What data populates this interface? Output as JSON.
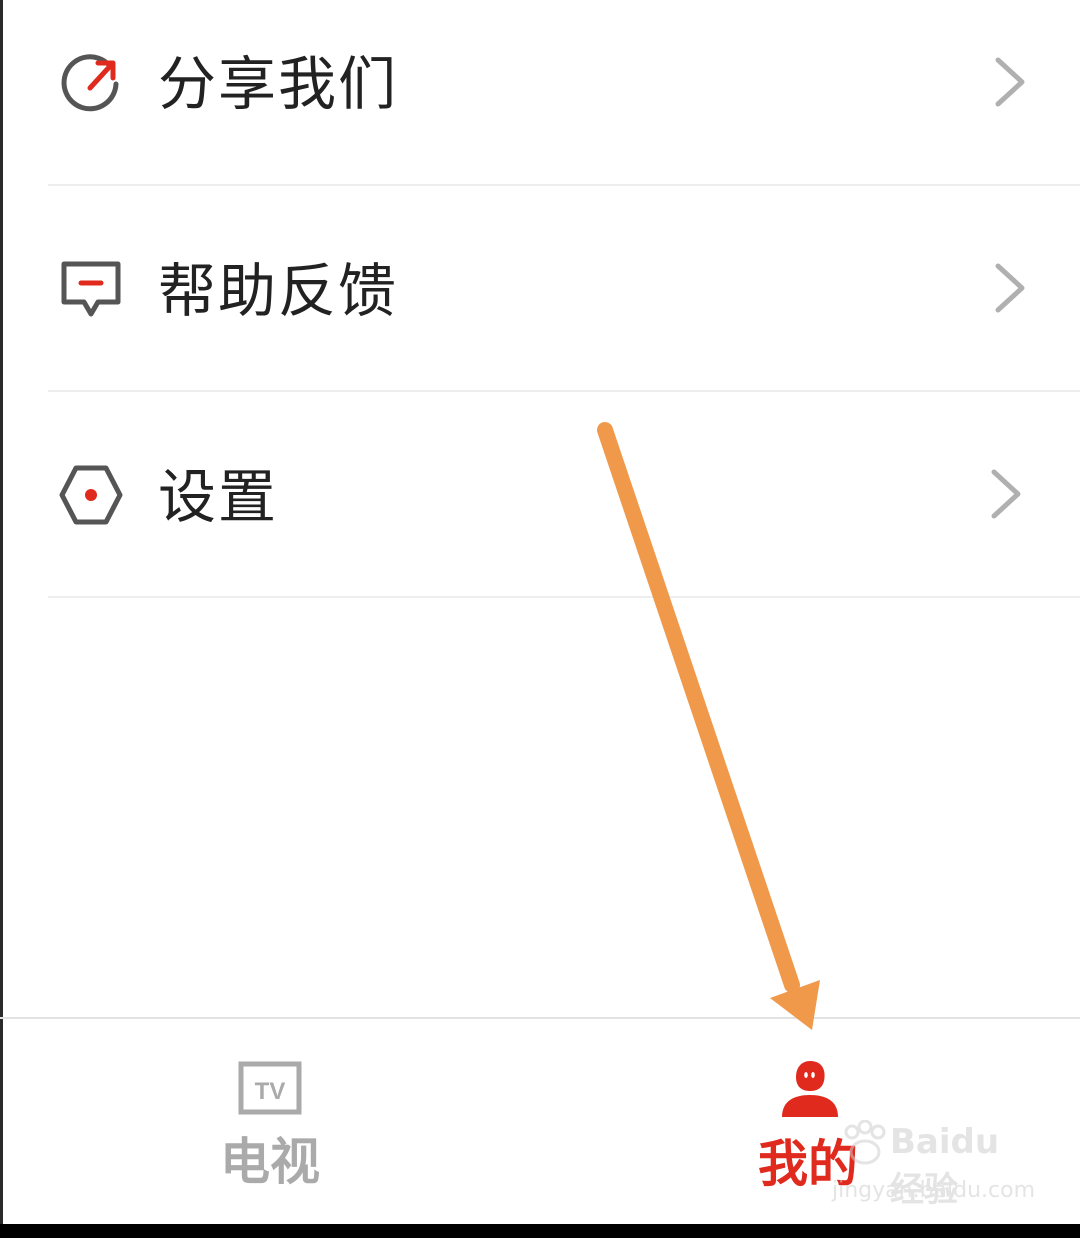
{
  "menu": {
    "items": [
      {
        "label": "分享我们",
        "icon": "share-icon"
      },
      {
        "label": "帮助反馈",
        "icon": "feedback-icon"
      },
      {
        "label": "设置",
        "icon": "settings-icon"
      }
    ]
  },
  "tabbar": {
    "tabs": [
      {
        "label": "电视",
        "icon": "tv-icon",
        "icon_text": "TV",
        "active": false
      },
      {
        "label": "我的",
        "icon": "profile-icon",
        "active": true
      }
    ]
  },
  "watermark": {
    "line1": "Baidu 经验",
    "line2": "jingyan.baidu.com"
  },
  "colors": {
    "accent": "#e02a1e",
    "text": "#222222",
    "icon_gray": "#555555",
    "chevron": "#b0b0b0",
    "inactive_tab": "#aaaaaa",
    "arrow": "#f0994a"
  }
}
